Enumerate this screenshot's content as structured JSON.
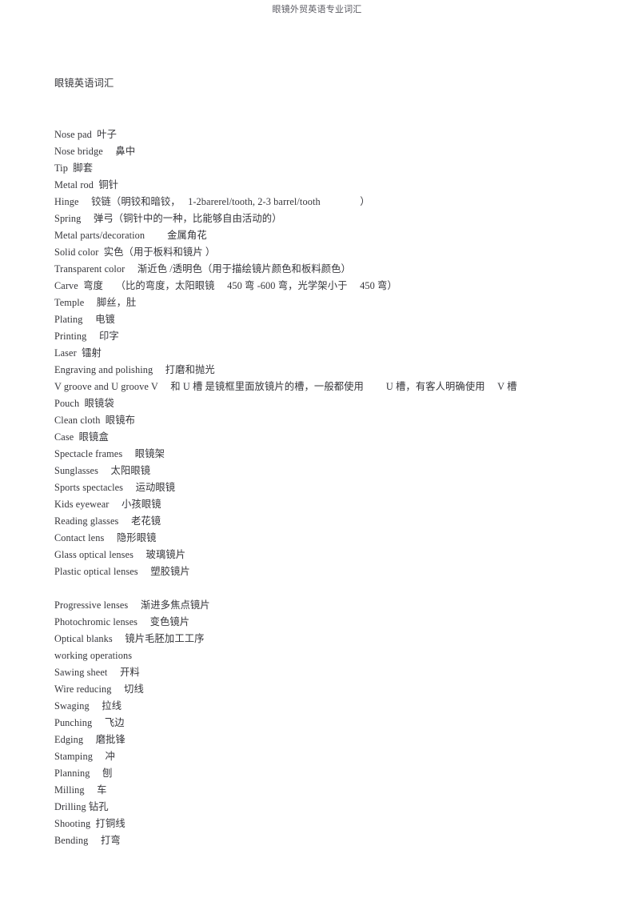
{
  "header": {
    "title": "眼镜外贸英语专业词汇"
  },
  "document": {
    "section_title": "眼镜英语词汇",
    "lines": [
      "Nose pad  叶子",
      "Nose bridge　 鼻中",
      "Tip  脚套",
      "Metal rod  铜针",
      "Hinge　 铰链（明铰和暗铰，　 1-2barerel/tooth, 2-3 barrel/tooth　　　　）",
      "Spring　 弹弓（铜针中的一种，比能够自由活动的）",
      "Metal parts/decoration　　 金属角花",
      "Solid color  实色（用于板料和镜片 ）",
      "Transparent color　 渐近色 /透明色（用于描绘镜片颜色和板料颜色）",
      "Carve  弯度　 （比的弯度，太阳眼镜　 450 弯 -600 弯，光学架小于　 450 弯）",
      "Temple　 脚丝，肚",
      "Plating　 电镀",
      "Printing　 印字",
      "Laser  镭射",
      "Engraving and polishing　 打磨和抛光",
      "V groove and U groove V　 和 U 槽 是镜框里面放镜片的槽，一般都使用　　 U 槽，有客人明确使用　 V 槽",
      "Pouch  眼镜袋",
      "Clean cloth  眼镜布",
      "Case  眼镜盒",
      "Spectacle frames　 眼镜架",
      "Sunglasses　 太阳眼镜",
      "Sports spectacles　 运动眼镜",
      "Kids eyewear　 小孩眼镜",
      "Reading glasses　 老花镜",
      "Contact lens　 隐形眼镜",
      "Glass optical lenses　 玻璃镜片",
      "Plastic optical lenses　 塑胶镜片",
      "",
      "Progressive lenses　 渐进多焦点镜片",
      "Photochromic lenses　 变色镜片",
      "Optical blanks　 镜片毛胚加工工序",
      "working operations",
      "Sawing sheet　 开料",
      "Wire reducing　 切线",
      "Swaging　 拉线",
      "Punching　 飞边",
      "Edging　 磨批锋",
      "Stamping　 冲",
      "Planning　 刨",
      "Milling　 车",
      "Drilling 钻孔",
      "Shooting  打铜线",
      "Bending　 打弯"
    ]
  },
  "colors": {
    "page_background": "#ffffff",
    "body_text": "#35353a",
    "header_text": "#5a5a62"
  }
}
